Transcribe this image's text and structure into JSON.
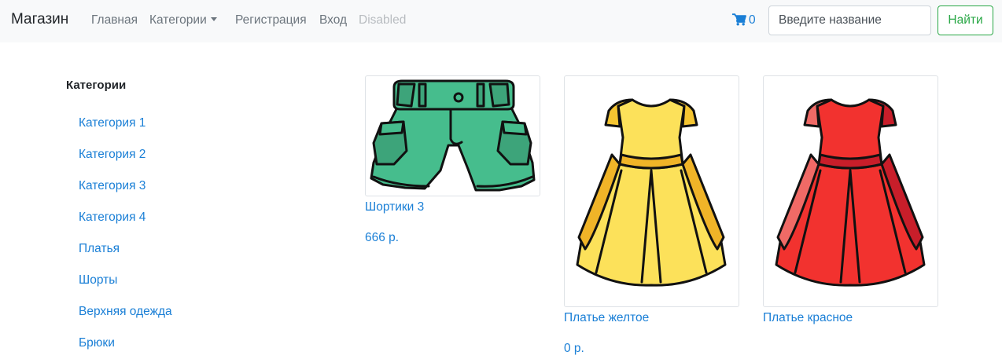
{
  "navbar": {
    "brand": "Магазин",
    "links": {
      "home": "Главная",
      "categories": "Категории",
      "register": "Регистрация",
      "login": "Вход",
      "disabled": "Disabled"
    },
    "cart_count": "0",
    "cart_icon": "shopping-cart-icon",
    "search_placeholder": "Введите название",
    "search_button": "Найти"
  },
  "sidebar": {
    "title": "Категории",
    "items": [
      {
        "label": "Категория 1"
      },
      {
        "label": "Категория 2"
      },
      {
        "label": "Категория 3"
      },
      {
        "label": "Категория 4"
      },
      {
        "label": "Платья"
      },
      {
        "label": "Шорты"
      },
      {
        "label": "Верхняя одежда"
      },
      {
        "label": "Брюки"
      }
    ]
  },
  "products": [
    {
      "name": "Шортики 3",
      "price": "666 р.",
      "image": "green-shorts-image"
    },
    {
      "name": "Платье желтое",
      "price": "0 р.",
      "image": "yellow-dress-image"
    },
    {
      "name": "Платье красное",
      "price": "",
      "image": "red-dress-image"
    }
  ],
  "colors": {
    "link": "#1a7fd6",
    "navbar_bg": "#f8f9fa",
    "success": "#28a745",
    "shorts": "#46bd8d",
    "dress_yellow": "#fce15a",
    "dress_red": "#f2322f"
  }
}
